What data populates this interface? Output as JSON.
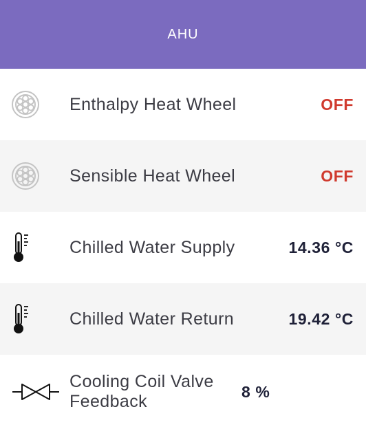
{
  "header": {
    "title": "AHU"
  },
  "rows": [
    {
      "label": "Enthalpy Heat Wheel",
      "value": "OFF",
      "icon": "heat-wheel-icon"
    },
    {
      "label": "Sensible Heat Wheel",
      "value": "OFF",
      "icon": "heat-wheel-icon"
    },
    {
      "label": "Chilled Water Supply",
      "value": "14.36 °C",
      "icon": "thermometer-icon"
    },
    {
      "label": "Chilled Water Return",
      "value": "19.42 °C",
      "icon": "thermometer-icon"
    },
    {
      "label": "Cooling Coil Valve Feedback",
      "value": "8 %",
      "icon": "valve-icon"
    }
  ],
  "colors": {
    "header_bg": "#7b6bbf",
    "off_status": "#d03a2e",
    "value_text": "#1f2138",
    "alt_row_bg": "#f5f5f5"
  }
}
